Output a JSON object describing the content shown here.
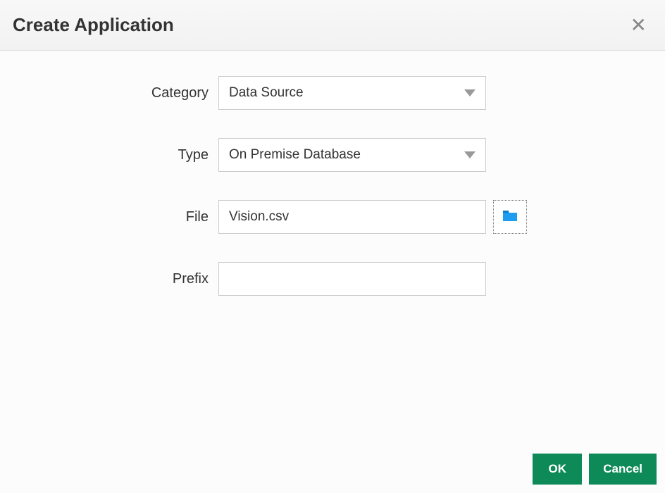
{
  "header": {
    "title": "Create Application"
  },
  "form": {
    "category": {
      "label": "Category",
      "value": "Data Source"
    },
    "type": {
      "label": "Type",
      "value": "On Premise Database"
    },
    "file": {
      "label": "File",
      "value": "Vision.csv"
    },
    "prefix": {
      "label": "Prefix",
      "value": ""
    }
  },
  "footer": {
    "ok": "OK",
    "cancel": "Cancel"
  }
}
